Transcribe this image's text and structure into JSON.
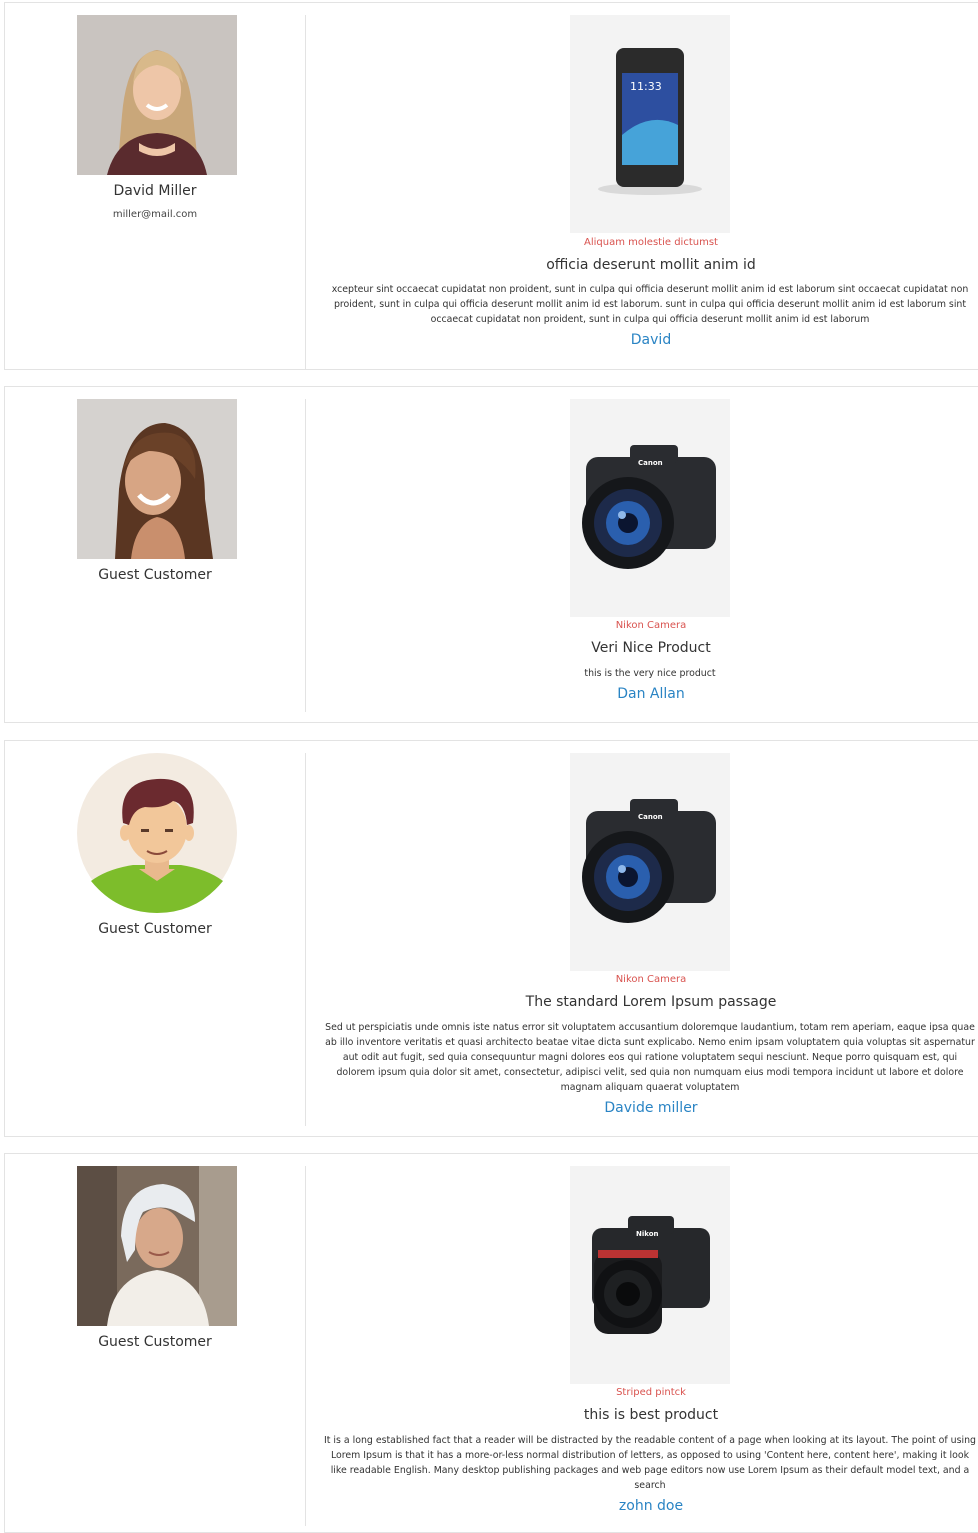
{
  "reviews": [
    {
      "reviewer": {
        "name": "David Miller",
        "email": "miller@mail.com",
        "avatar": "woman-blonde-photo"
      },
      "product": {
        "name": "Aliquam molestie dictumst",
        "image": "smartphone-image"
      },
      "title": "officia deserunt mollit anim id",
      "text": "xcepteur sint occaecat cupidatat non proident, sunt in culpa qui officia deserunt mollit anim id est laborum sint occaecat cupidatat non proident, sunt in culpa qui officia deserunt mollit anim id est laborum. sunt in culpa qui officia deserunt mollit anim id est laborum sint occaecat cupidatat non proident, sunt in culpa qui officia deserunt mollit anim id est laborum",
      "author": "David"
    },
    {
      "reviewer": {
        "name": "Guest Customer",
        "avatar": "woman-brunette-photo"
      },
      "product": {
        "name": "Nikon Camera",
        "image": "camera-image"
      },
      "title": "Veri Nice Product",
      "text": "this is the very nice product",
      "author": "Dan Allan"
    },
    {
      "reviewer": {
        "name": "Guest Customer",
        "avatar": "man-cartoon-avatar"
      },
      "product": {
        "name": "Nikon Camera",
        "image": "camera-image"
      },
      "title": "The standard Lorem Ipsum passage",
      "text": "Sed ut perspiciatis unde omnis iste natus error sit voluptatem accusantium doloremque laudantium, totam rem aperiam, eaque ipsa quae ab illo inventore veritatis et quasi architecto beatae vitae dicta sunt explicabo. Nemo enim ipsam voluptatem quia voluptas sit aspernatur aut odit aut fugit, sed quia consequuntur magni dolores eos qui ratione voluptatem sequi nesciunt. Neque porro quisquam est, qui dolorem ipsum quia dolor sit amet, consectetur, adipisci velit, sed quia non numquam eius modi tempora incidunt ut labore et dolore magnam aliquam quaerat voluptatem",
      "author": "Davide miller"
    },
    {
      "reviewer": {
        "name": "Guest Customer",
        "avatar": "woman-headscarf-photo"
      },
      "product": {
        "name": "Striped pintck",
        "image": "camera-image"
      },
      "title": "this is best product",
      "text": "It is a long established fact that a reader will be distracted by the readable content of a page when looking at its layout. The point of using Lorem Ipsum is that it has a more-or-less normal distribution of letters, as opposed to using 'Content here, content here', making it look like readable English. Many desktop publishing packages and web page editors now use Lorem Ipsum as their default model text, and a search",
      "author": "zohn doe"
    }
  ],
  "colors": {
    "product_name": "#d9534f",
    "author_link": "#2a84c4",
    "border": "#e3e3e3",
    "image_background": "#f3f3f3"
  }
}
